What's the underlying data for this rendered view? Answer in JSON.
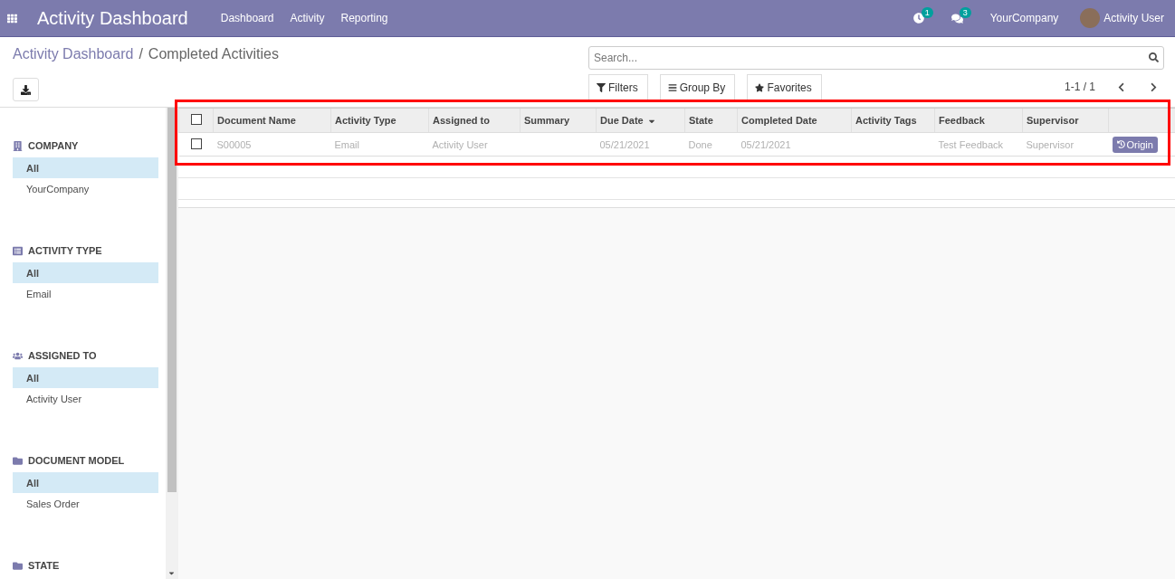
{
  "navbar": {
    "app_title": "Activity Dashboard",
    "menu": [
      "Dashboard",
      "Activity",
      "Reporting"
    ],
    "activity_count": "1",
    "message_count": "3",
    "company": "YourCompany",
    "user": "Activity User"
  },
  "breadcrumb": {
    "parent": "Activity Dashboard",
    "separator": "/",
    "current": "Completed Activities"
  },
  "search": {
    "placeholder": "Search..."
  },
  "search_buttons": [
    "Filters",
    "Group By",
    "Favorites"
  ],
  "pager": "1-1 / 1",
  "sidebar": [
    {
      "title": "COMPANY",
      "items": [
        {
          "label": "All",
          "selected": true
        },
        {
          "label": "YourCompany",
          "selected": false
        }
      ]
    },
    {
      "title": "ACTIVITY TYPE",
      "items": [
        {
          "label": "All",
          "selected": true
        },
        {
          "label": "Email",
          "selected": false
        }
      ]
    },
    {
      "title": "ASSIGNED TO",
      "items": [
        {
          "label": "All",
          "selected": true
        },
        {
          "label": "Activity User",
          "selected": false
        }
      ]
    },
    {
      "title": "DOCUMENT MODEL",
      "items": [
        {
          "label": "All",
          "selected": true
        },
        {
          "label": "Sales Order",
          "selected": false
        }
      ]
    },
    {
      "title": "STATE"
    }
  ],
  "table": {
    "header_checked": false,
    "columns": [
      {
        "label": "Document Name",
        "sorted": false
      },
      {
        "label": "Activity Type",
        "sorted": false
      },
      {
        "label": "Assigned to",
        "sorted": false
      },
      {
        "label": "Summary",
        "sorted": false
      },
      {
        "label": "Due Date",
        "sorted": true
      },
      {
        "label": "State",
        "sorted": false
      },
      {
        "label": "Completed Date",
        "sorted": false
      },
      {
        "label": "Activity Tags",
        "sorted": false
      },
      {
        "label": "Feedback",
        "sorted": false
      },
      {
        "label": "Supervisor",
        "sorted": false
      }
    ],
    "rows": [
      {
        "checked": false,
        "cells": [
          "S00005",
          "Email",
          "Activity User",
          "",
          "05/21/2021",
          "Done",
          "05/21/2021",
          "",
          "Test Feedback",
          "Supervisor"
        ],
        "action": "Origin"
      }
    ]
  }
}
